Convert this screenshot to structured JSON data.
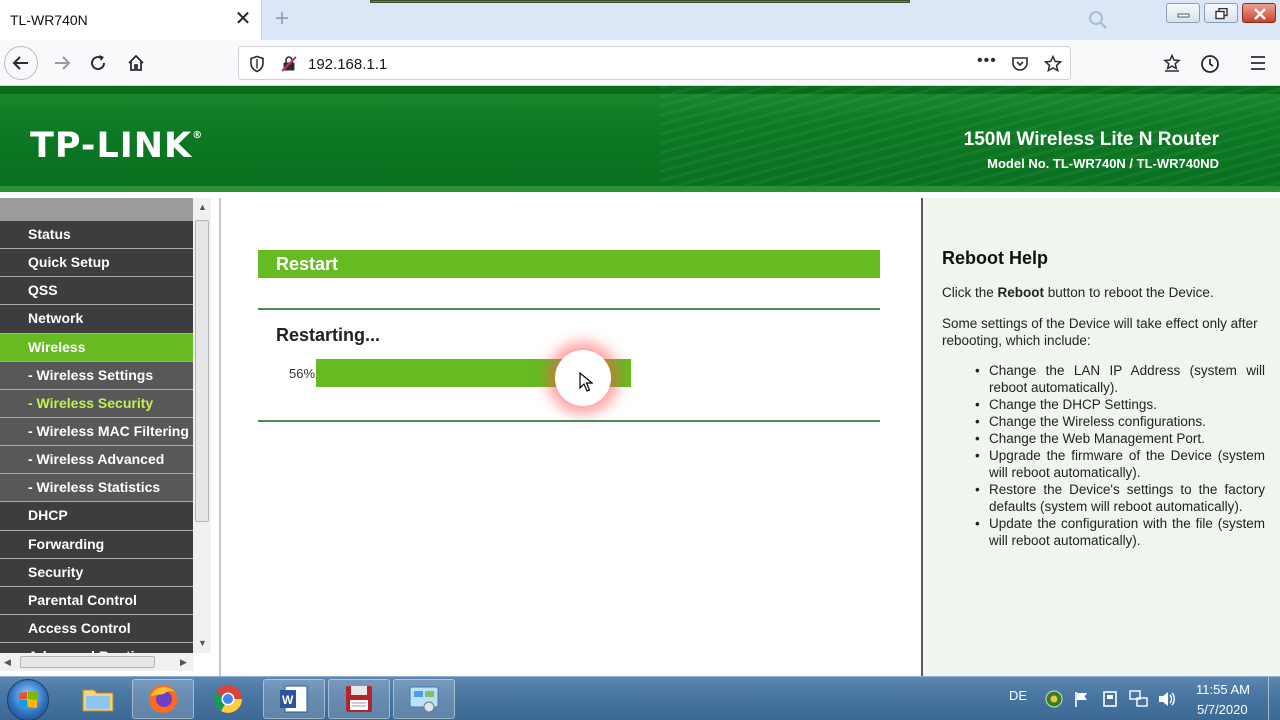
{
  "browser": {
    "tab_title": "TL-WR740N",
    "tab_close": "✕",
    "new_tab": "+",
    "url": "192.168.1.1",
    "url_menu": "•••"
  },
  "router": {
    "logo": "TP-LINK",
    "logo_mark": "®",
    "product": "150M Wireless Lite N Router",
    "model": "Model No. TL-WR740N / TL-WR740ND"
  },
  "sidebar": {
    "items": [
      {
        "label": "Status",
        "kind": "top"
      },
      {
        "label": "Quick Setup",
        "kind": "top"
      },
      {
        "label": "QSS",
        "kind": "top"
      },
      {
        "label": "Network",
        "kind": "top"
      },
      {
        "label": "Wireless",
        "kind": "active"
      },
      {
        "label": "- Wireless Settings",
        "kind": "sub"
      },
      {
        "label": "- Wireless Security",
        "kind": "sub-active"
      },
      {
        "label": "- Wireless MAC Filtering",
        "kind": "sub"
      },
      {
        "label": "- Wireless Advanced",
        "kind": "sub"
      },
      {
        "label": "- Wireless Statistics",
        "kind": "sub"
      },
      {
        "label": "DHCP",
        "kind": "top"
      },
      {
        "label": "Forwarding",
        "kind": "top"
      },
      {
        "label": "Security",
        "kind": "top"
      },
      {
        "label": "Parental Control",
        "kind": "top"
      },
      {
        "label": "Access Control",
        "kind": "top"
      },
      {
        "label": "Advanced Routing",
        "kind": "top"
      }
    ]
  },
  "main": {
    "section_title": "Restart",
    "status": "Restarting...",
    "progress_label": "56%",
    "progress_value": 56
  },
  "help": {
    "title": "Reboot Help",
    "intro_pre": "Click the ",
    "intro_bold": "Reboot",
    "intro_post": " button to reboot the Device.",
    "para": "Some settings of the Device will take effect only after rebooting, which include:",
    "items": [
      "Change the LAN IP Address (system will reboot automatically).",
      "Change the DHCP Settings.",
      "Change the Wireless configurations.",
      "Change the Web Management Port.",
      "Upgrade the firmware of the Device (system will reboot automatically).",
      "Restore the Device's settings to the factory defaults (system will reboot automatically).",
      "Update the configuration with the file (system will reboot automatically)."
    ]
  },
  "taskbar": {
    "lang": "DE",
    "time": "11:55 AM",
    "date": "5/7/2020"
  }
}
